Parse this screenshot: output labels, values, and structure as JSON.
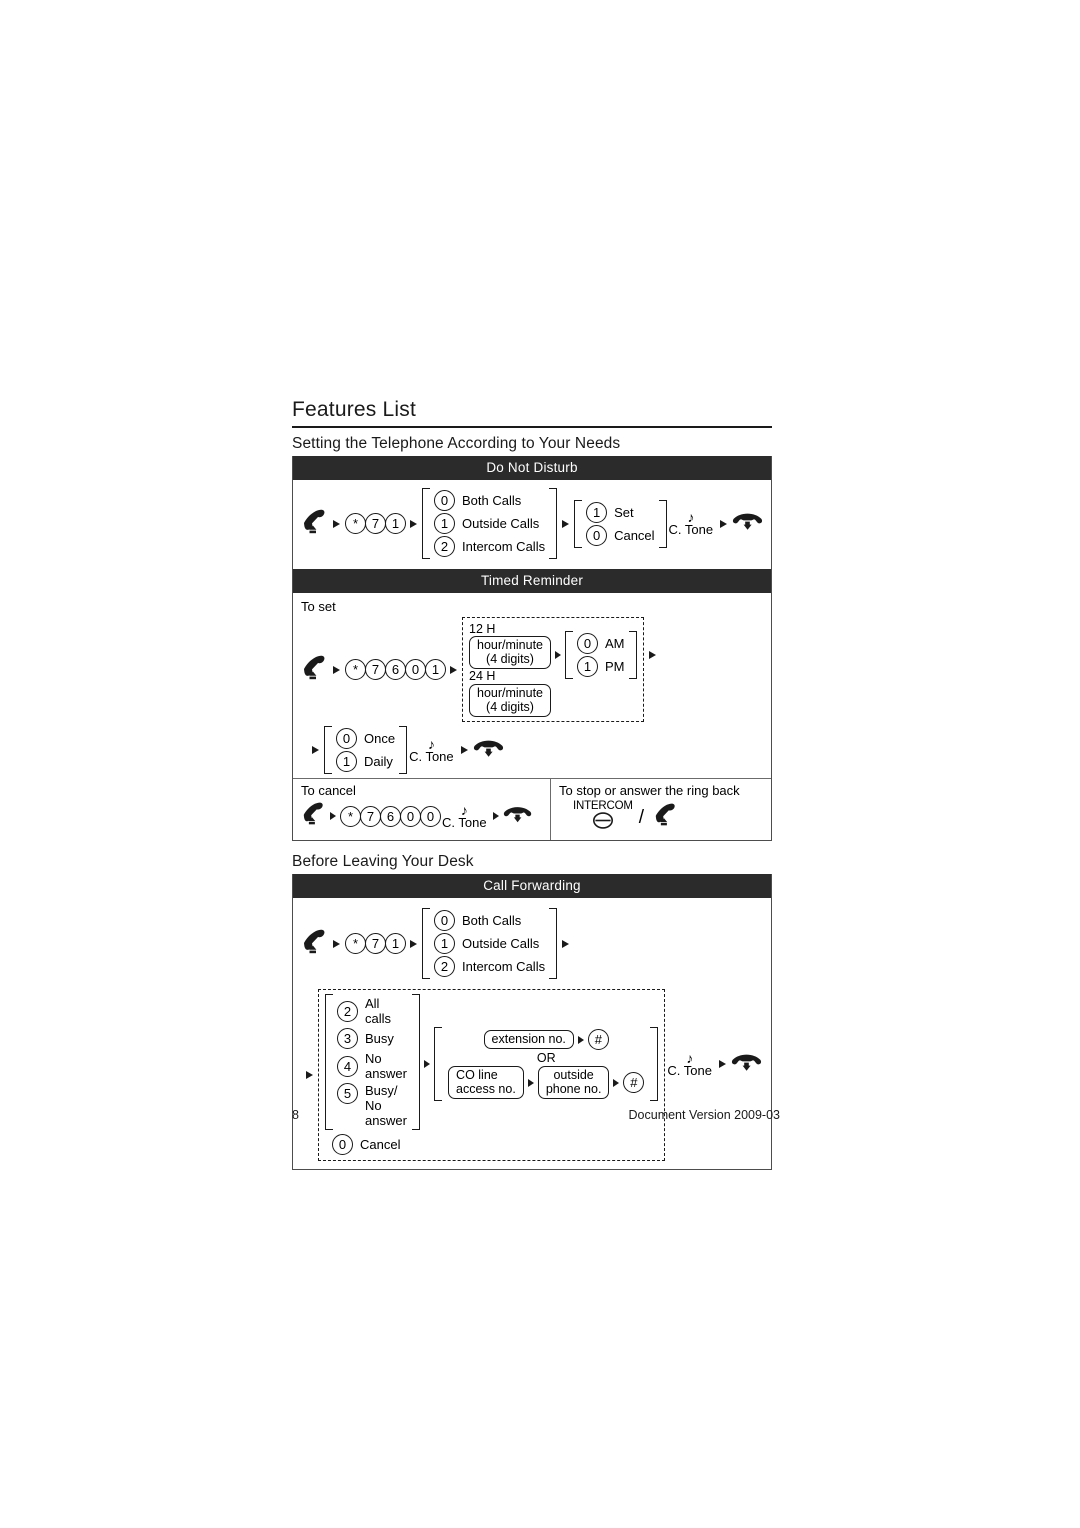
{
  "document": {
    "title": "Features List",
    "page_number": "8",
    "version": "Document Version 2009-03"
  },
  "sections": [
    {
      "title": "Setting the Telephone According to Your Needs",
      "features": [
        {
          "name": "Do Not Disturb",
          "steps": {
            "code": [
              "*",
              "7",
              "1"
            ],
            "call_type_options": [
              {
                "key": "0",
                "label": "Both Calls"
              },
              {
                "key": "1",
                "label": "Outside Calls"
              },
              {
                "key": "2",
                "label": "Intercom Calls"
              }
            ],
            "set_cancel_options": [
              {
                "key": "1",
                "label": "Set"
              },
              {
                "key": "0",
                "label": "Cancel"
              }
            ],
            "confirmation_tone": "C. Tone"
          }
        },
        {
          "name": "Timed Reminder",
          "to_set_label": "To set",
          "to_cancel_label": "To cancel",
          "ring_back_label": "To stop or answer the ring back",
          "set": {
            "code": [
              "*",
              "7",
              "6",
              "0",
              "1"
            ],
            "time_formats": [
              {
                "format": "12 H",
                "entry": "hour/minute\n(4 digits)"
              },
              {
                "format": "24 H",
                "entry": "hour/minute\n(4 digits)"
              }
            ],
            "ampm_options": [
              {
                "key": "0",
                "label": "AM"
              },
              {
                "key": "1",
                "label": "PM"
              }
            ],
            "frequency_options": [
              {
                "key": "0",
                "label": "Once"
              },
              {
                "key": "1",
                "label": "Daily"
              }
            ],
            "confirmation_tone": "C. Tone"
          },
          "cancel": {
            "code": [
              "*",
              "7",
              "6",
              "0",
              "0"
            ],
            "confirmation_tone": "C. Tone"
          },
          "ring_back": {
            "intercom_label": "INTERCOM",
            "separator": "/"
          }
        }
      ]
    },
    {
      "title": "Before Leaving Your Desk",
      "features": [
        {
          "name": "Call Forwarding",
          "steps": {
            "code": [
              "*",
              "7",
              "1"
            ],
            "call_type_options": [
              {
                "key": "0",
                "label": "Both Calls"
              },
              {
                "key": "1",
                "label": "Outside Calls"
              },
              {
                "key": "2",
                "label": "Intercom Calls"
              }
            ],
            "forward_options": [
              {
                "key": "2",
                "label": "All calls"
              },
              {
                "key": "3",
                "label": "Busy"
              },
              {
                "key": "4",
                "label": "No answer"
              },
              {
                "key": "5",
                "label": "Busy/\nNo answer"
              }
            ],
            "cancel_option": {
              "key": "0",
              "label": "Cancel"
            },
            "destination": {
              "extension_box": "extension no.",
              "hash_key": "#",
              "or_label": "OR",
              "co_line_box": "CO line\naccess no.",
              "outside_phone_box": "outside\nphone no."
            },
            "confirmation_tone": "C. Tone"
          }
        }
      ]
    }
  ],
  "icons": {
    "offhook": "lift-handset-icon",
    "onhook": "hang-up-handset-icon",
    "tone": "♪"
  },
  "colors": {
    "header_bar": "#2b2b2b",
    "text": "#1a1a1a",
    "border": "#4d4d4d"
  }
}
